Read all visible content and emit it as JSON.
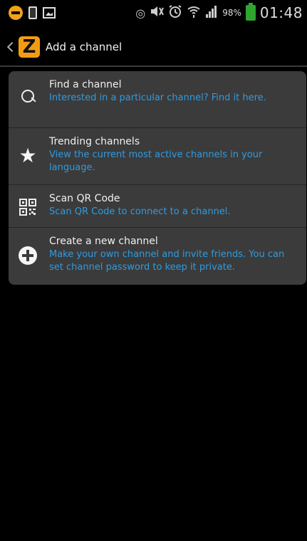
{
  "statusbar": {
    "battery_percent": "98%",
    "time": "01:48",
    "battery_level": 0.98,
    "icons": [
      "minus-badge-icon",
      "sim-icon",
      "image-icon",
      "eye-icon",
      "mute-icon",
      "alarm-icon",
      "wifi-icon",
      "signal-icon",
      "battery-icon"
    ]
  },
  "actionbar": {
    "title": "Add a channel",
    "logo_letter": "Z",
    "accent": "#f39c12"
  },
  "menu": {
    "items": [
      {
        "title": "Find a channel",
        "description": "Interested in a particular channel? Find it here.",
        "icon": "search-icon"
      },
      {
        "title": "Trending channels",
        "description": "View the current most active channels in your language.",
        "icon": "star-icon"
      },
      {
        "title": "Scan QR Code",
        "description": "Scan QR Code to connect to a channel.",
        "icon": "qr-code-icon"
      },
      {
        "title": "Create a new channel",
        "description": "Make your own channel and invite friends. You can set channel password to keep it private.",
        "icon": "plus-circle-icon"
      }
    ]
  },
  "colors": {
    "description_text": "#2f9be0",
    "card_background": "#3b3b3b"
  }
}
